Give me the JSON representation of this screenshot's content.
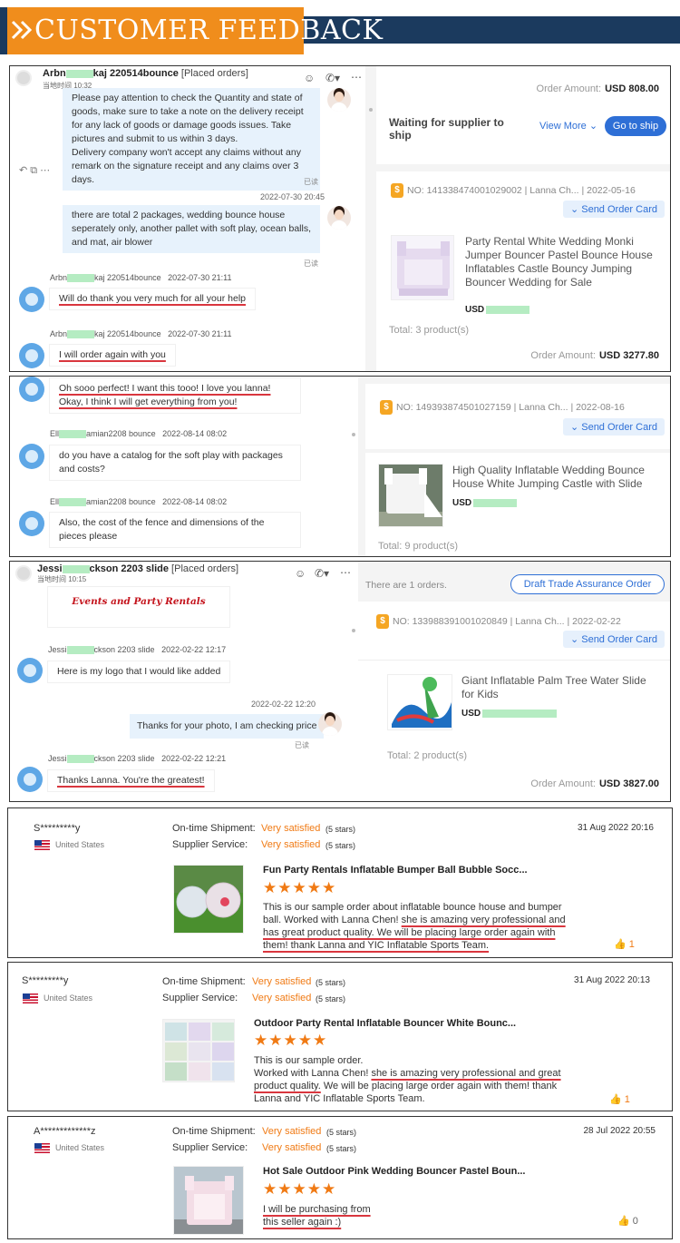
{
  "banner": {
    "title": "CUSTOMER FEEDBACK"
  },
  "panel1": {
    "header": {
      "name_prefix": "Arbn",
      "name_suffix": "kaj 220514bounce",
      "tag": "[Placed orders]",
      "subtitle": "当地时间 10:32"
    },
    "messages": [
      {
        "text": "Please pay attention to check the Quantity and state of goods, make sure to take a note on the delivery receipt for any lack of goods or damage goods issues. Take pictures and submit to us within 3 days.\nDelivery company won't accept any claims without any remark on the signature receipt and any claims over 3 days."
      },
      {
        "read": "已读",
        "time": "2022-07-30 20:45"
      },
      {
        "text": "there are total 2 packages, wedding bounce house seperately only, another pallet with soft play, ocean balls, and mat, air blower",
        "read": "已读"
      },
      {
        "sender_prefix": "Arbn",
        "sender_suffix": "kaj 220514bounce",
        "time": "2022-07-30 21:11",
        "text": "Will do thank you very much for all your help"
      },
      {
        "sender_prefix": "Arbn",
        "sender_suffix": "kaj 220514bounce",
        "time": "2022-07-30 21:11",
        "text": "I will order again with you"
      }
    ],
    "right": {
      "order_amount_label": "Order Amount:",
      "order_amount": "USD 808.00",
      "waiting": "Waiting for supplier to ship",
      "view_more": "View More",
      "go_ship": "Go to ship",
      "order_no": "NO: 141338474001029002 | Lanna Ch... | 2022-05-16",
      "send_card": "Send Order Card",
      "product": "Party Rental White Wedding Monki Jumper Bouncer Pastel Bounce House Inflatables Castle Bouncy Jumping Bouncer Wedding for Sale",
      "usd": "USD",
      "total": "Total:  3 product(s)",
      "amount_label": "Order Amount:",
      "amount": "USD 3277.80"
    }
  },
  "panel2": {
    "messages": [
      {
        "text": "Oh sooo perfect! I want this tooo! I love you lanna! Okay, I think I will get everything from you!"
      },
      {
        "sender_prefix": "Ell",
        "sender_suffix": "amian2208 bounce",
        "time": "2022-08-14 08:02",
        "text": "do you have a catalog for the soft play with packages and costs?"
      },
      {
        "sender_prefix": "Ell",
        "sender_suffix": "amian2208 bounce",
        "time": "2022-08-14 08:02",
        "text": "Also, the cost of the fence and dimensions of the pieces please"
      }
    ],
    "right": {
      "order_no": "NO: 149393874501027159 | Lanna Ch... | 2022-08-16",
      "send_card": "Send Order Card",
      "product": "High Quality Inflatable Wedding Bounce House White Jumping Castle with Slide",
      "usd": "USD",
      "total": "Total:  9 product(s)"
    }
  },
  "panel3": {
    "header": {
      "name_prefix": "Jessi",
      "name_suffix": "ckson 2203 slide",
      "tag": "[Placed orders]",
      "subtitle": "当地时间 10:15"
    },
    "logo_text": "Events and Party Rentals",
    "messages": [
      {
        "sender_prefix": "Jessi",
        "sender_suffix": "ckson 2203 slide",
        "time": "2022-02-22 12:17",
        "text": "Here is my logo that I would like added"
      },
      {
        "time": "2022-02-22 12:20",
        "text": "Thanks for your photo, I am checking price",
        "read": "已读"
      },
      {
        "sender_prefix": "Jessi",
        "sender_suffix": "ckson 2203 slide",
        "time": "2022-02-22 12:21",
        "text": "Thanks Lanna. You're the greatest!"
      }
    ],
    "right": {
      "orders_count": "There are 1 orders.",
      "draft": "Draft Trade Assurance Order",
      "order_no": "NO: 133988391001020849 | Lanna Ch... | 2022-02-22",
      "send_card": "Send Order Card",
      "product": "Giant Inflatable Palm Tree Water Slide for Kids",
      "usd": "USD",
      "total": "Total:  2 product(s)",
      "amount_label": "Order Amount:",
      "amount": "USD 3827.00"
    }
  },
  "reviews": [
    {
      "name": "S*********y",
      "country": "United States",
      "shipment_label": "On-time Shipment:",
      "shipment_value": "Very satisfied",
      "shipment_stars": "(5 stars)",
      "service_label": "Supplier Service:",
      "service_value": "Very satisfied",
      "service_stars": "(5 stars)",
      "date": "31 Aug 2022 20:16",
      "title": "Fun Party Rentals Inflatable Bumper Ball Bubble Socc...",
      "rating": 5,
      "text_plain": "This is our sample order about inflatable bounce house and bumper ball. Worked with Lanna Chen! ",
      "text_ul": "she is amazing very professional and has great product quality. We will be placing large order again with them! thank Lanna and YIC Inflatable Sports Team.",
      "likes": "1"
    },
    {
      "name": "S*********y",
      "country": "United States",
      "shipment_label": "On-time Shipment:",
      "shipment_value": "Very satisfied",
      "shipment_stars": "(5 stars)",
      "service_label": "Supplier Service:",
      "service_value": "Very satisfied",
      "service_stars": "(5 stars)",
      "date": "31 Aug 2022 20:13",
      "title": "Outdoor Party Rental Inflatable Bouncer White Bounc...",
      "rating": 5,
      "text_plain": "This is our sample order.\nWorked with Lanna Chen! ",
      "text_ul": "she is amazing very professional and great product quality.",
      "text_after": " We will be placing large order again with them! thank Lanna and YIC Inflatable Sports Team.",
      "likes": "1"
    },
    {
      "name": "A*************z",
      "country": "United States",
      "shipment_label": "On-time Shipment:",
      "shipment_value": "Very satisfied",
      "shipment_stars": "(5 stars)",
      "service_label": "Supplier Service:",
      "service_value": "Very satisfied",
      "service_stars": "(5 stars)",
      "date": "28 Jul 2022 20:55",
      "title": "Hot Sale Outdoor Pink Wedding Bouncer Pastel Boun...",
      "rating": 5,
      "text_ul": "I will be purchasing from this seller again :)",
      "likes": "0"
    }
  ],
  "colors": {
    "orange": "#f08d1c",
    "navy": "#1b3a5e",
    "accent_blue": "#2e6fd6",
    "satisfied": "#f07a14",
    "underline_red": "#d9363e",
    "bubble_blue": "#e7f2fc"
  }
}
